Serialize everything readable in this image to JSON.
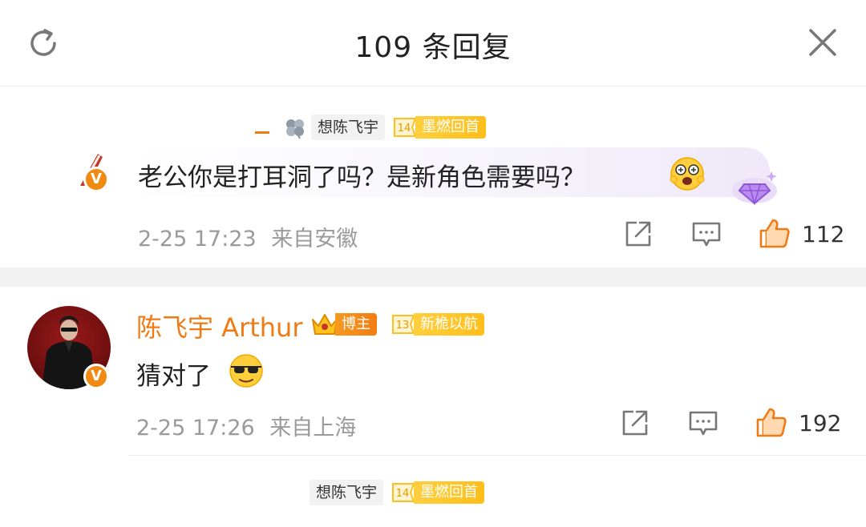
{
  "header": {
    "title": "109 条回复",
    "refresh_icon": "refresh-icon",
    "close_icon": "close-icon"
  },
  "colors": {
    "accent_orange": "#f07a16",
    "badge_yellow": "#ffc21f",
    "meta_gray": "#9a9a9a",
    "separator": "#f2f2f2"
  },
  "comment1": {
    "reply_to_name": "想陈飞宇",
    "fan_level": "14",
    "fan_title": "墨燃回首",
    "text": "老公你是打耳洞了吗？是新角色需要吗？",
    "time": "2-25 17:23",
    "location": "来自安徽",
    "likes": "112"
  },
  "comment2": {
    "author": "陈飞宇 Arthur",
    "host_label": "博主",
    "fan_level": "13",
    "fan_title": "新桅以航",
    "text": "猜对了",
    "time": "2-25 17:26",
    "location": "来自上海",
    "likes": "192"
  },
  "comment3": {
    "reply_to_name": "想陈飞宇",
    "fan_level": "14",
    "fan_title": "墨燃回首"
  },
  "verified_mark": "V"
}
